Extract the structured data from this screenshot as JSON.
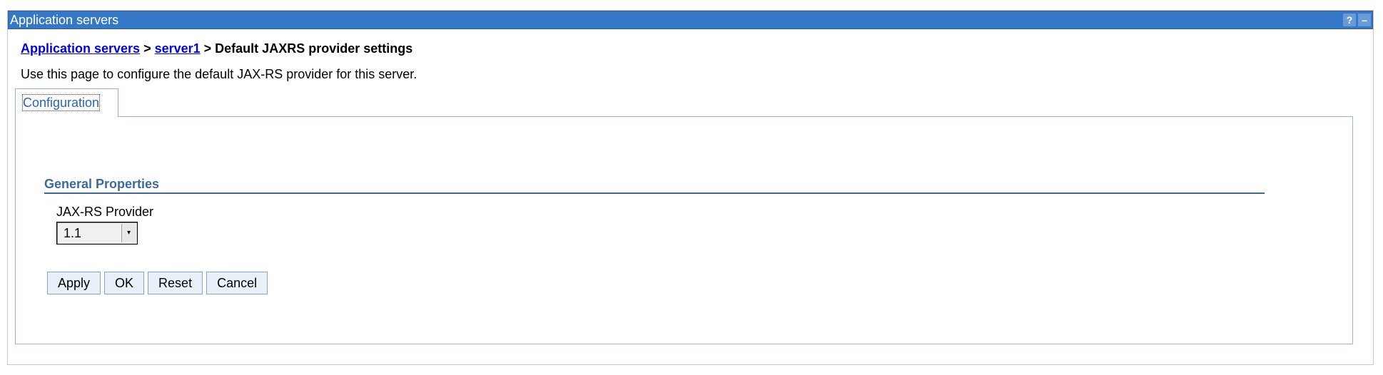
{
  "titlebar": {
    "title": "Application servers",
    "help_label": "?",
    "minimize_label": "–"
  },
  "breadcrumb": {
    "link1": "Application servers",
    "separator1": " > ",
    "link2": "server1",
    "separator2": " > ",
    "current": "Default JAXRS provider settings"
  },
  "description": "Use this page to configure the default JAX-RS provider for this server.",
  "tabs": [
    {
      "label": "Configuration",
      "active": true
    }
  ],
  "general_properties": {
    "title": "General Properties",
    "jaxrs_provider": {
      "label": "JAX-RS Provider",
      "value": "1.1",
      "arrow_icon": "▾"
    }
  },
  "buttons": {
    "apply": "Apply",
    "ok": "OK",
    "reset": "Reset",
    "cancel": "Cancel"
  },
  "colors": {
    "titlebar_bg": "#3678c8",
    "link": "#0000ee",
    "section_title": "#3a6a9e",
    "tab_label": "#2a63b6"
  }
}
